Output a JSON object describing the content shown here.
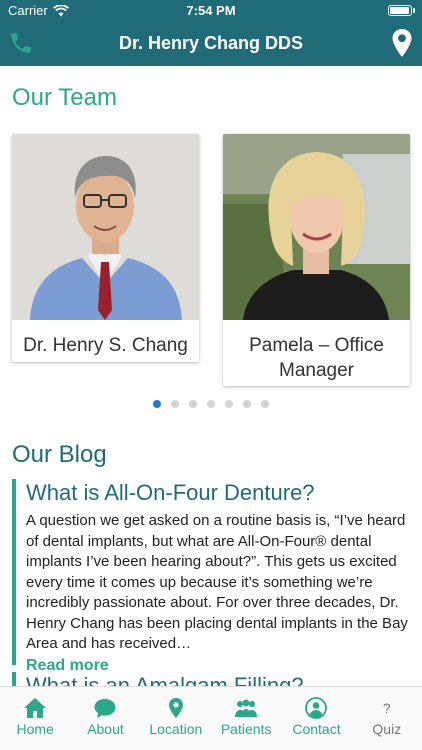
{
  "status": {
    "carrier": "Carrier",
    "time": "7:54 PM"
  },
  "header": {
    "title": "Dr. Henry Chang DDS",
    "left_icon": "phone-icon",
    "right_icon": "location-pin-icon"
  },
  "team": {
    "title": "Our Team",
    "members": [
      {
        "name": "Dr. Henry S. Chang"
      },
      {
        "name": "Pamela – Office Manager"
      }
    ],
    "page_count": 7,
    "active_page": 0
  },
  "blog": {
    "title": "Our Blog",
    "posts": [
      {
        "title": "What is All-On-Four Denture?",
        "excerpt": "A question we get asked on a routine basis is, “I’ve heard of dental implants, but what are All-On-Four® dental implants I’ve been hearing about?”. This gets us excited every time it comes up because it’s something we’re incredibly passionate about. For over three decades, Dr. Henry Chang has been placing dental implants in the Bay Area and has received…",
        "read_more": "Read more"
      },
      {
        "title": "What is an Amalgam Filling?"
      }
    ]
  },
  "tabs": [
    {
      "label": "Home",
      "icon": "home-icon"
    },
    {
      "label": "About",
      "icon": "speech-bubble-icon"
    },
    {
      "label": "Location",
      "icon": "location-pin-icon"
    },
    {
      "label": "Patients",
      "icon": "people-icon"
    },
    {
      "label": "Contact",
      "icon": "contact-person-icon"
    },
    {
      "label": "Quiz",
      "icon": "question-mark-icon"
    }
  ],
  "colors": {
    "header": "#1f6b78",
    "accent": "#2ba889",
    "active_dot": "#1e7bd8"
  }
}
